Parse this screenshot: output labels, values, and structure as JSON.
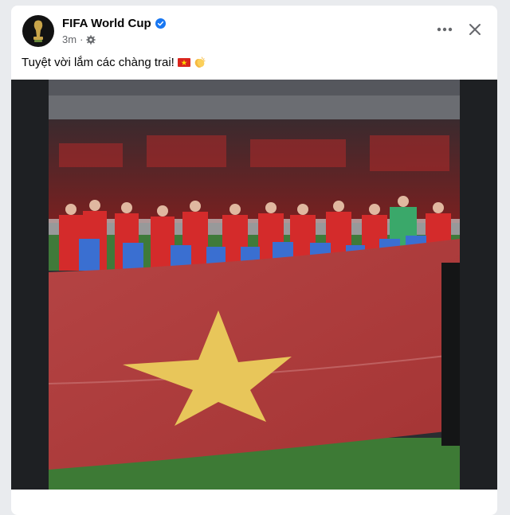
{
  "post": {
    "page_name": "FIFA World Cup",
    "verified_icon": "verified-badge-icon",
    "timestamp": "3m",
    "separator": "·",
    "audience_icon": "gear-icon",
    "text": "Tuyệt vời lắm các chàng trai!",
    "emojis": [
      "vietnam-flag-emoji",
      "clapping-hands-emoji"
    ],
    "actions": {
      "more_icon": "more-options-icon",
      "close_icon": "close-icon"
    }
  },
  "photo": {
    "description_icon": "team-photo-image",
    "colors": {
      "flag_red": "#b23b3b",
      "star_yellow": "#e8c65a",
      "jersey_red": "#d42b2b",
      "kids_blue": "#3a6fd1",
      "keeper_green": "#3aa86a"
    }
  }
}
